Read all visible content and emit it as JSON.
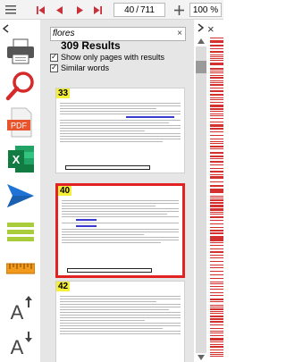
{
  "toolbar": {
    "menu_icon": "hamburger-icon",
    "first_icon": "first-page-icon",
    "prev_icon": "previous-page-icon",
    "next_icon": "next-page-icon",
    "last_icon": "last-page-icon",
    "current_page": "40",
    "page_separator": "/",
    "total_pages": "711",
    "zoom_in_icon": "plus-icon",
    "zoom": "100 %"
  },
  "sidebar": {
    "collapse_icon": "chevron-left-icon",
    "items": [
      "printer-icon",
      "search-icon",
      "pdf-icon",
      "excel-icon",
      "send-icon",
      "lines-icon",
      "ruler-icon",
      "font-increase-icon",
      "font-decrease-icon"
    ],
    "pdf_label": "PDF",
    "excel_label": "X",
    "font_up_label": "A",
    "font_down_label": "A"
  },
  "search": {
    "value": "flores",
    "clear_label": "×",
    "results": "309 Results",
    "options": [
      {
        "label": "Show only pages with results",
        "checked": true
      },
      {
        "label": "Similar words",
        "checked": true
      }
    ]
  },
  "thumbnails": [
    {
      "page": "33",
      "selected": false
    },
    {
      "page": "40",
      "selected": true
    },
    {
      "page": "42",
      "selected": false
    }
  ],
  "right_panel": {
    "close_label": "×",
    "collapse_icon": "chevron-right-icon",
    "up_icon": "scroll-up-icon",
    "down_icon": "scroll-down-icon"
  },
  "colors": {
    "accent_red": "#e12222",
    "page_badge": "#f6ef3a",
    "nav_red": "#c9303a"
  }
}
